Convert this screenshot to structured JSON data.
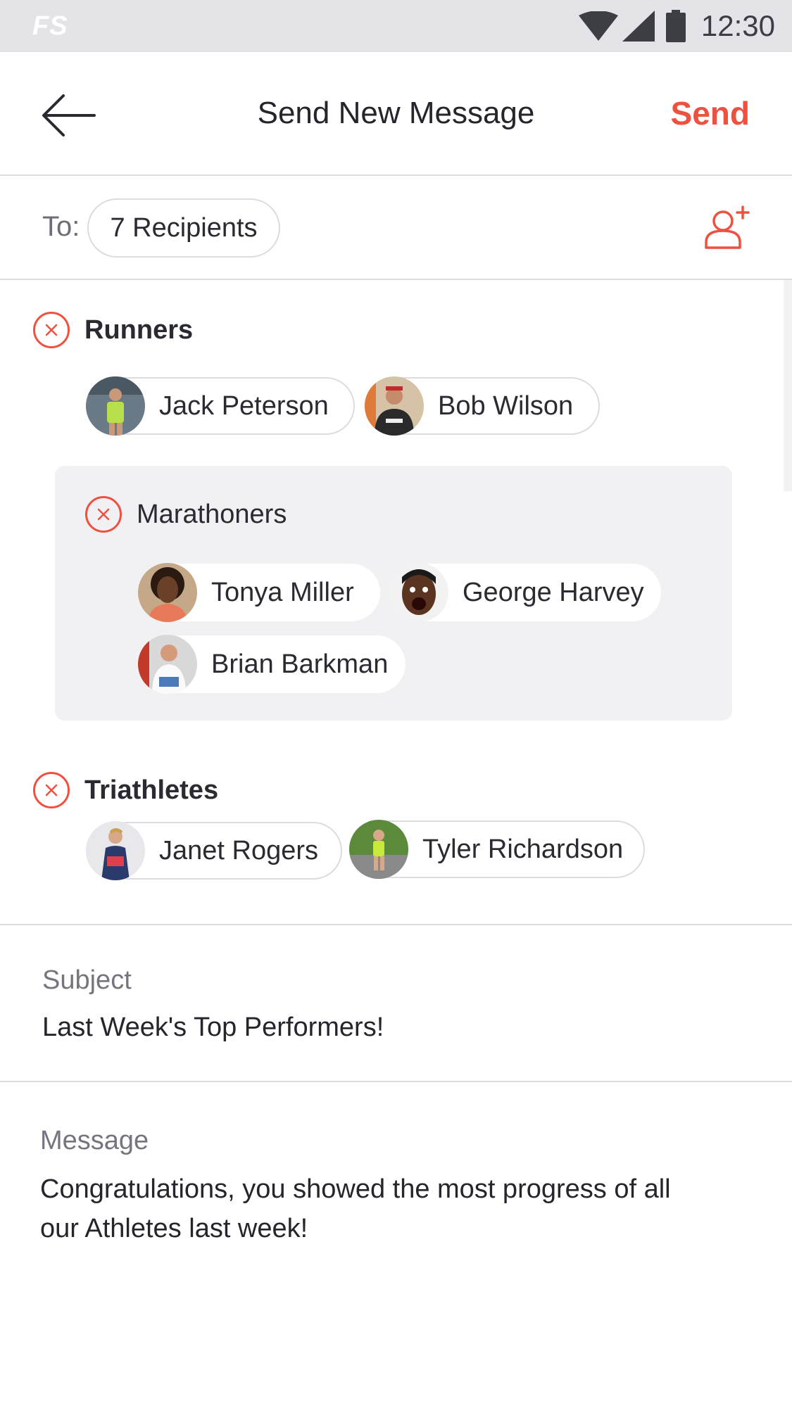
{
  "status_bar": {
    "logo": "FS",
    "time": "12:30"
  },
  "app_bar": {
    "title": "Send New Message",
    "send_label": "Send"
  },
  "to_row": {
    "label": "To:",
    "recipients_label": "7 Recipients"
  },
  "groups": {
    "runners": {
      "title": "Runners",
      "members": [
        "Jack Peterson",
        "Bob Wilson"
      ]
    },
    "marathoners": {
      "title": "Marathoners",
      "members": [
        "Tonya Miller",
        "George Harvey",
        "Brian Barkman"
      ]
    },
    "triathletes": {
      "title": "Triathletes",
      "members": [
        "Janet Rogers",
        "Tyler Richardson"
      ]
    }
  },
  "subject": {
    "label": "Subject",
    "value": "Last Week's Top Performers!"
  },
  "message": {
    "label": "Message",
    "value": "Congratulations, you showed the most progress of all our Athletes last week!"
  },
  "colors": {
    "accent": "#ee5140",
    "divider": "#dcdce0",
    "nested_bg": "#f1f1f4"
  }
}
